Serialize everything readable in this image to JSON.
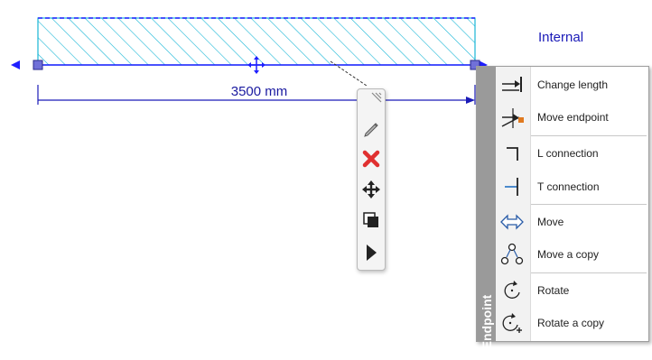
{
  "drawing": {
    "dimension_label": "3500 mm",
    "side_label": "Internal",
    "colors": {
      "hatch": "#19b6d6",
      "selection": "#1e1eff",
      "grip_fill": "#7070d8",
      "dimension": "#1a1ab8"
    }
  },
  "mini_toolbar": {
    "buttons": [
      {
        "name": "edit",
        "icon": "pencil-icon"
      },
      {
        "name": "delete",
        "icon": "red-x-icon"
      },
      {
        "name": "move",
        "icon": "four-arrow-move-icon"
      },
      {
        "name": "copy",
        "icon": "copy-squares-icon"
      },
      {
        "name": "more",
        "icon": "play-triangle-icon"
      }
    ]
  },
  "context_menu": {
    "title": "Endpoint",
    "items": [
      {
        "label": "Change length",
        "icon": "change-length-icon"
      },
      {
        "label": "Move endpoint",
        "icon": "move-endpoint-icon"
      },
      {
        "label": "L connection",
        "icon": "l-connection-icon"
      },
      {
        "label": "T connection",
        "icon": "t-connection-icon"
      },
      {
        "label": "Move",
        "icon": "move-arrows-icon"
      },
      {
        "label": "Move a copy",
        "icon": "move-copy-icon"
      },
      {
        "label": "Rotate",
        "icon": "rotate-icon"
      },
      {
        "label": "Rotate a copy",
        "icon": "rotate-copy-icon"
      }
    ]
  }
}
